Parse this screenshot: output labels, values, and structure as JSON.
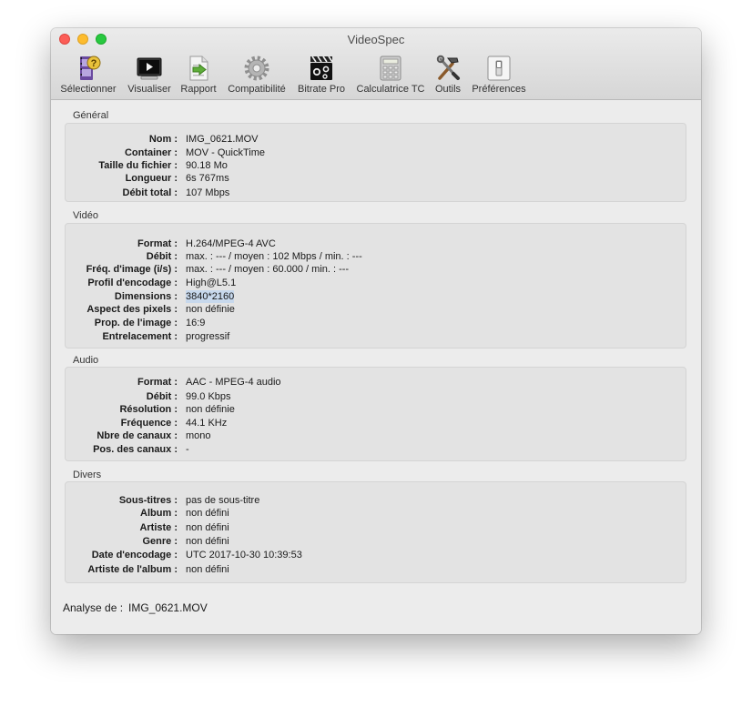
{
  "window": {
    "title": "VideoSpec"
  },
  "toolbar": [
    {
      "name": "selectionner",
      "label": "Sélectionner",
      "icon": "film-question-icon"
    },
    {
      "name": "visualiser",
      "label": "Visualiser",
      "icon": "monitor-play-icon"
    },
    {
      "name": "rapport",
      "label": "Rapport",
      "icon": "export-document-icon"
    },
    {
      "name": "compatibilite",
      "label": "Compatibilité",
      "icon": "gear-icon"
    },
    {
      "name": "bitrate-pro",
      "label": "Bitrate Pro",
      "icon": "clapperboard-icon"
    },
    {
      "name": "calculatrice-tc",
      "label": "Calculatrice TC",
      "icon": "calculator-icon"
    },
    {
      "name": "outils",
      "label": "Outils",
      "icon": "tools-icon"
    },
    {
      "name": "preferences",
      "label": "Préférences",
      "icon": "switch-icon"
    }
  ],
  "sections": {
    "general": {
      "title": "Général",
      "rows": [
        {
          "label": "Nom :",
          "value": "IMG_0621.MOV"
        },
        {
          "label": "Container :",
          "value": "MOV - QuickTime"
        },
        {
          "label": "Taille du fichier :",
          "value": "90.18 Mo"
        },
        {
          "label": "Longueur :",
          "value": "6s 767ms"
        },
        {
          "label": "Débit total :",
          "value": "107 Mbps"
        }
      ]
    },
    "video": {
      "title": "Vidéo",
      "rows": [
        {
          "label": "Format :",
          "value": "H.264/MPEG-4 AVC"
        },
        {
          "label": "Débit :",
          "value": "max. : --- / moyen : 102 Mbps / min. : ---"
        },
        {
          "label": "Fréq. d'image (i/s) :",
          "value": "max. : --- / moyen : 60.000 / min. : ---"
        },
        {
          "label": "Profil d'encodage :",
          "value": "High@L5.1"
        },
        {
          "label": "Dimensions :",
          "value": "3840*2160"
        },
        {
          "label": "Aspect des pixels :",
          "value": "non définie"
        },
        {
          "label": "Prop. de l'image :",
          "value": "16:9"
        },
        {
          "label": "Entrelacement :",
          "value": "progressif"
        }
      ]
    },
    "audio": {
      "title": "Audio",
      "rows": [
        {
          "label": "Format :",
          "value": "AAC - MPEG-4 audio"
        },
        {
          "label": "Débit :",
          "value": "99.0 Kbps"
        },
        {
          "label": "Résolution :",
          "value": "non définie"
        },
        {
          "label": "Fréquence :",
          "value": "44.1 KHz"
        },
        {
          "label": "Nbre de canaux :",
          "value": "mono"
        },
        {
          "label": "Pos. des canaux :",
          "value": "-"
        }
      ]
    },
    "divers": {
      "title": "Divers",
      "rows": [
        {
          "label": "Sous-titres :",
          "value": "pas de sous-titre"
        },
        {
          "label": "Album :",
          "value": "non défini"
        },
        {
          "label": "Artiste :",
          "value": "non défini"
        },
        {
          "label": "Genre :",
          "value": "non défini"
        },
        {
          "label": "Date d'encodage :",
          "value": "UTC 2017-10-30 10:39:53"
        },
        {
          "label": "Artiste de l'album :",
          "value": "non défini"
        }
      ]
    }
  },
  "footer": {
    "label": "Analyse de :",
    "value": "IMG_0621.MOV"
  }
}
